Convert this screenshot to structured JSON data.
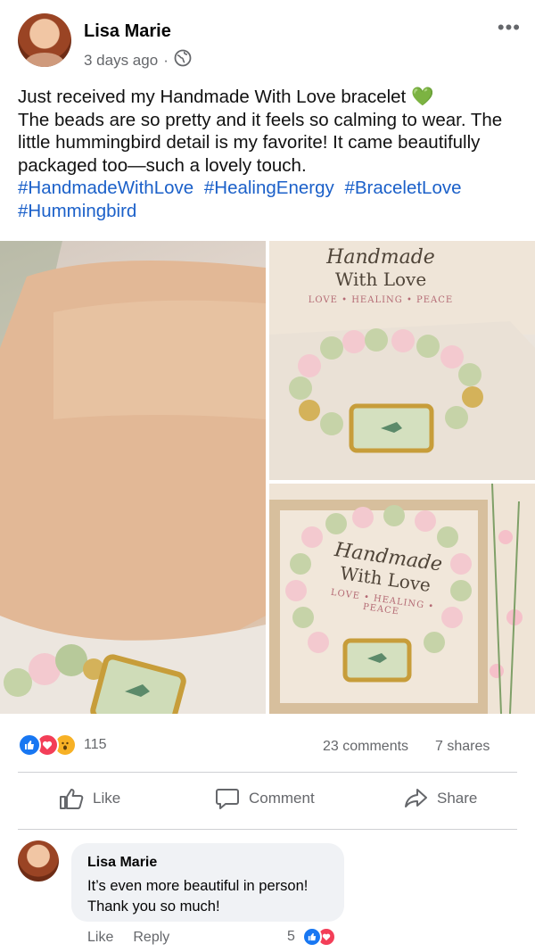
{
  "post": {
    "author": "Lisa Marie",
    "time": "3 days ago",
    "more_label": "•••",
    "text_line": "Just received my Handmade With Love bracelet 💚",
    "text_rest": "The beads are so pretty and it feels so calming to wear. The little hummingbird detail is my favorite! It came beautifully packaged too—such a lovely touch.",
    "hashtags": [
      "#HandmadeWithLove",
      "#HealingEnergy",
      "#BraceletLove",
      "#Hummingbird"
    ]
  },
  "photos": {
    "card_script": "Handmade",
    "card_main": "With Love",
    "card_tag": "LOVE • HEALING • PEACE",
    "box_script": "Handmade",
    "box_main": "With Love",
    "box_tag": "LOVE • HEALING • PEACE"
  },
  "stats": {
    "reaction_icons": [
      "like-icon",
      "love-icon",
      "wow-icon"
    ],
    "reaction_count": "115",
    "comments": "23 comments",
    "shares": "7 shares"
  },
  "actions": {
    "like": "Like",
    "comment": "Comment",
    "share": "Share"
  },
  "comment": {
    "author": "Lisa Marie",
    "text": "It’s even more beautiful in person! Thank you so much!",
    "like": "Like",
    "reply": "Reply",
    "reaction_count": "5"
  },
  "colors": {
    "hashtag": "#1b60c9",
    "like_blue": "#1877f2",
    "love_red": "#f33e58",
    "wow_yellow": "#f7b125"
  }
}
